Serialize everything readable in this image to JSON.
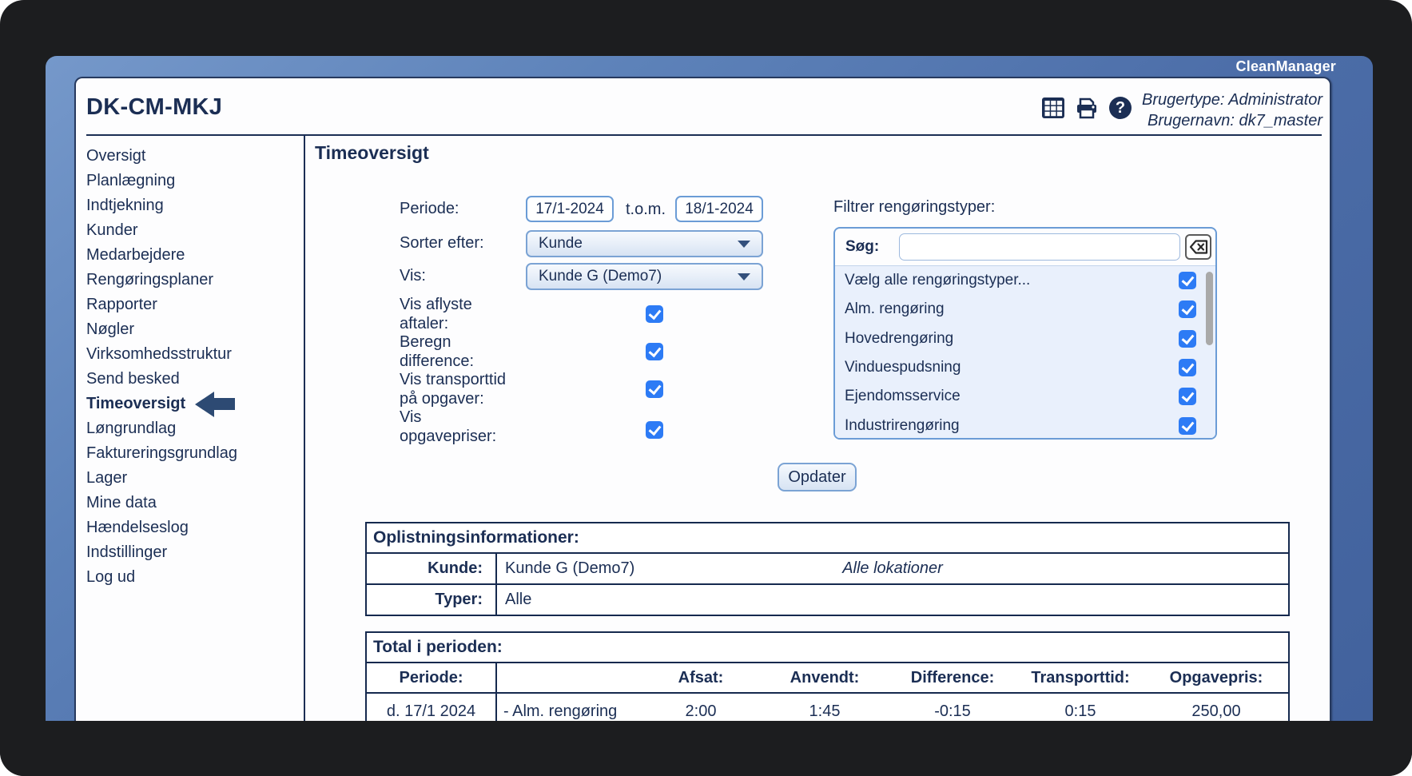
{
  "window": {
    "brand": "CleanManager",
    "title": "DK-CM-MKJ",
    "usertype": "Brugertype: Administrator",
    "username": "Brugernavn: dk7_master",
    "icons": [
      "table-grid",
      "printer",
      "help"
    ]
  },
  "colors": {
    "accent_navy": "#1b2e54",
    "checkbox_blue": "#2d7bf5",
    "panel_blue": "#4b6ca7"
  },
  "sidebar": {
    "items": [
      {
        "label": "Oversigt"
      },
      {
        "label": "Planlægning"
      },
      {
        "label": "Indtjekning"
      },
      {
        "label": "Kunder"
      },
      {
        "label": "Medarbejdere"
      },
      {
        "label": "Rengøringsplaner"
      },
      {
        "label": "Rapporter"
      },
      {
        "label": "Nøgler"
      },
      {
        "label": "Virksomhedsstruktur"
      },
      {
        "label": "Send besked"
      },
      {
        "label": "Timeoversigt",
        "active": true
      },
      {
        "label": "Løngrundlag"
      },
      {
        "label": "Faktureringsgrundlag"
      },
      {
        "label": "Lager"
      },
      {
        "label": "Mine data"
      },
      {
        "label": "Hændelseslog"
      },
      {
        "label": "Indstillinger"
      },
      {
        "label": "Log ud"
      }
    ]
  },
  "main": {
    "heading": "Timeoversigt",
    "form": {
      "periode_label": "Periode:",
      "periode_from": "17/1-2024",
      "tom_label": "t.o.m.",
      "periode_to": "18/1-2024",
      "sorter_label": "Sorter efter:",
      "sorter_value": "Kunde",
      "vis_label": "Vis:",
      "vis_value": "Kunde G (Demo7)",
      "checkboxes": [
        {
          "label": "Vis aflyste aftaler:",
          "checked": true
        },
        {
          "label": "Beregn difference:",
          "checked": true
        },
        {
          "label": "Vis transporttid på opgaver:",
          "checked": true
        },
        {
          "label": "Vis opgavepriser:",
          "checked": true
        }
      ]
    },
    "filter": {
      "heading": "Filtrer rengøringstyper:",
      "search_label": "Søg:",
      "search_value": "",
      "items": [
        {
          "label": "Vælg alle rengøringstyper...",
          "checked": true
        },
        {
          "label": "Alm. rengøring",
          "checked": true
        },
        {
          "label": "Hovedrengøring",
          "checked": true
        },
        {
          "label": "Vinduespudsning",
          "checked": true
        },
        {
          "label": "Ejendomsservice",
          "checked": true
        },
        {
          "label": "Industrirengøring",
          "checked": true
        }
      ]
    },
    "update_button": "Opdater",
    "info_table": {
      "title": "Oplistningsinformationer:",
      "rows": [
        {
          "label": "Kunde:",
          "value": "Kunde G (Demo7)",
          "note": "Alle lokationer"
        },
        {
          "label": "Typer:",
          "value": "Alle",
          "note": ""
        }
      ]
    },
    "totals_table": {
      "title": "Total i perioden:",
      "columns": [
        "Periode:",
        "",
        "Afsat:",
        "Anvendt:",
        "Difference:",
        "Transporttid:",
        "Opgavepris:"
      ],
      "rows": [
        {
          "periode": "d. 17/1 2024",
          "type": "- Alm. rengøring",
          "afsat": "2:00",
          "anvendt": "1:45",
          "difference": "-0:15",
          "transporttid": "0:15",
          "opgavepris": "250,00"
        }
      ]
    }
  }
}
